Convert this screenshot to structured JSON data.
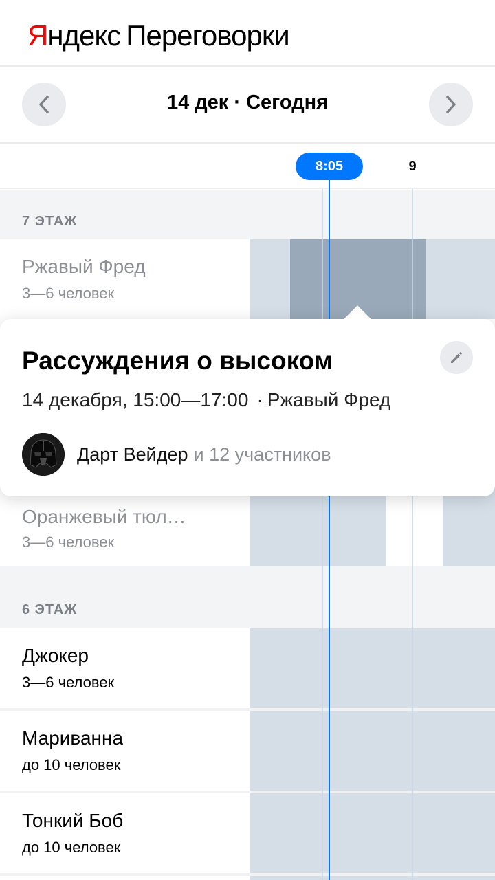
{
  "header": {
    "logo_first_letter": "Я",
    "logo_rest": "ндекс",
    "product": "Переговорки"
  },
  "date_nav": {
    "prev_icon": "chevron-left-icon",
    "next_icon": "chevron-right-icon",
    "date_label": "14 дек · Сегодня"
  },
  "timeline": {
    "now_time": "8:05",
    "hour_label": "9"
  },
  "floors": [
    {
      "label": "7 ЭТАЖ",
      "rooms": [
        {
          "name": "Ржавый Фред",
          "capacity": "3—6 человек"
        },
        {
          "name": "Оранжевый тюл…",
          "capacity": "3—6 человек"
        }
      ]
    },
    {
      "label": "6 ЭТАЖ",
      "rooms": [
        {
          "name": "Джокер",
          "capacity": "3—6 человек"
        },
        {
          "name": "Мариванна",
          "capacity": "до 10 человек"
        },
        {
          "name": "Тонкий Боб",
          "capacity": "до 10 человек"
        }
      ]
    }
  ],
  "event_card": {
    "title": "Рассуждения о высоком",
    "date_time": "14 декабря, 15:00—17:00",
    "separator": "·",
    "room": "Ржавый Фред",
    "organizer": "Дарт Вейдер",
    "participants": "и 12 участников",
    "edit_icon": "pencil-icon",
    "avatar_icon": "darth-vader-avatar"
  },
  "colors": {
    "logo_red": "#ff0000",
    "accent_blue": "#0077ff",
    "timeline_free": "#d5dee7",
    "booking": "#9aa9b9",
    "muted_text": "#8c9095"
  }
}
